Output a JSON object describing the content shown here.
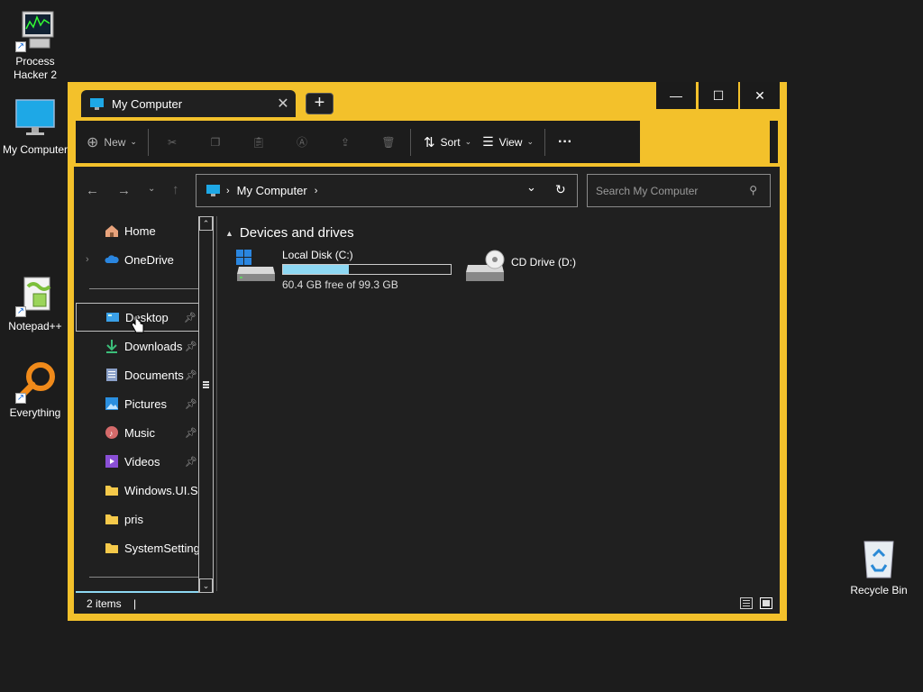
{
  "desktop": {
    "icons": [
      {
        "label": "Process\nHacker 2",
        "icon": "process-hacker-icon"
      },
      {
        "label": "My Computer",
        "icon": "monitor-icon"
      },
      {
        "label": "Notepad++",
        "icon": "notepadpp-icon"
      },
      {
        "label": "Everything",
        "icon": "magnifier-icon"
      },
      {
        "label": "Recycle Bin",
        "icon": "recycle-bin-icon"
      }
    ]
  },
  "window": {
    "tab_title": "My Computer",
    "new_tab": "+",
    "controls": {
      "minimize": "—",
      "maximize": "☐",
      "close": "✕"
    },
    "accent_color": "#f3c12b"
  },
  "toolbar": {
    "new_label": "New",
    "sort_label": "Sort",
    "view_label": "View",
    "more_label": "···"
  },
  "address": {
    "crumb": "My Computer",
    "search_placeholder": "Search My Computer"
  },
  "sidebar": {
    "items": [
      {
        "label": "Home",
        "icon": "home-icon",
        "pinned": false
      },
      {
        "label": "OneDrive",
        "icon": "onedrive-icon",
        "pinned": false
      },
      {
        "label": "Desktop",
        "icon": "desktop-folder-icon",
        "pinned": true
      },
      {
        "label": "Downloads",
        "icon": "download-icon",
        "pinned": true
      },
      {
        "label": "Documents",
        "icon": "documents-icon",
        "pinned": true
      },
      {
        "label": "Pictures",
        "icon": "pictures-icon",
        "pinned": true
      },
      {
        "label": "Music",
        "icon": "music-icon",
        "pinned": true
      },
      {
        "label": "Videos",
        "icon": "videos-icon",
        "pinned": true
      },
      {
        "label": "Windows.UI.Settings",
        "icon": "folder-icon",
        "pinned": false
      },
      {
        "label": "pris",
        "icon": "folder-icon",
        "pinned": false
      },
      {
        "label": "SystemSettings",
        "icon": "folder-icon",
        "pinned": false
      }
    ]
  },
  "content": {
    "section_title": "Devices and drives",
    "drives": [
      {
        "name": "Local Disk (C:)",
        "free_text": "60.4 GB free of 99.3 GB",
        "used_fraction": 0.39
      },
      {
        "name": "CD Drive (D:)"
      }
    ]
  },
  "status": {
    "items_text": "2 items"
  }
}
